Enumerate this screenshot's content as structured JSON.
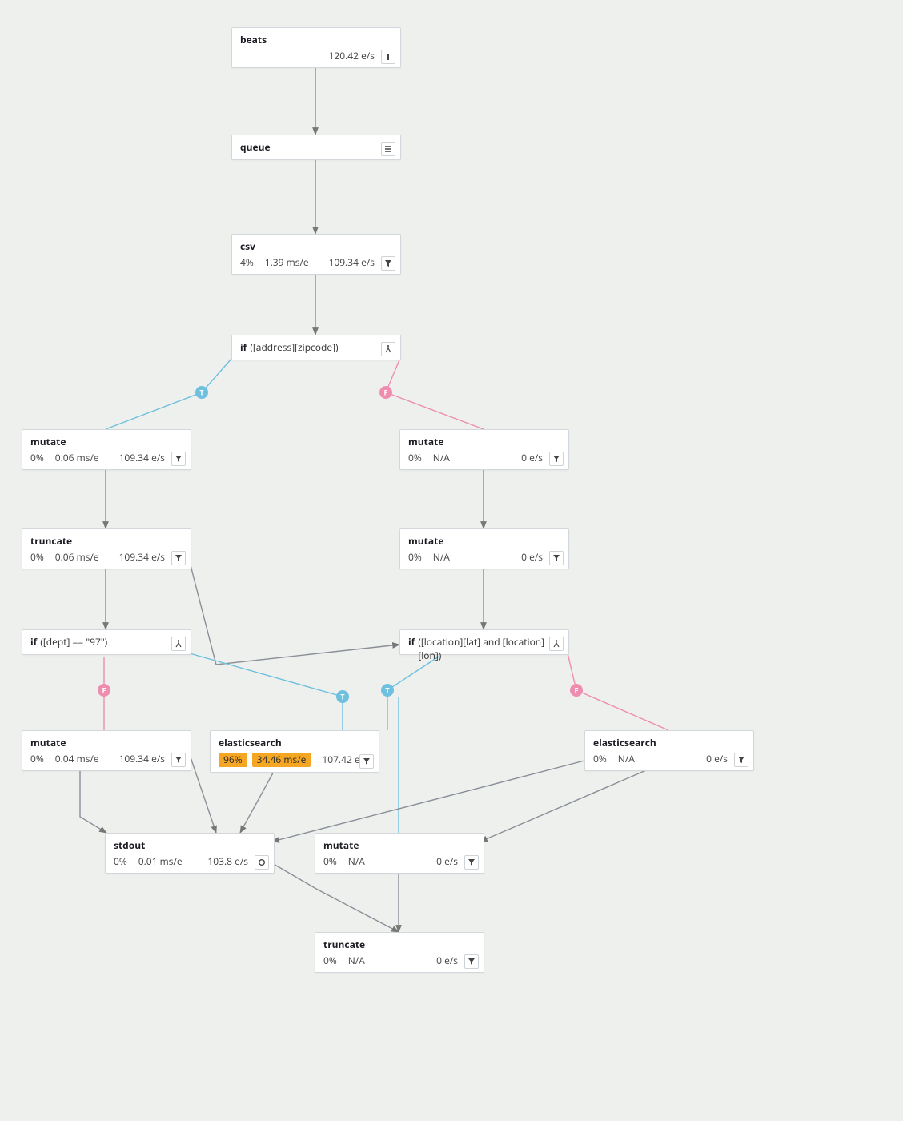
{
  "colors": {
    "true_branch": "#6ec0de",
    "false_branch": "#ef8db0",
    "highlight": "#f5a623"
  },
  "branch_labels": {
    "true": "T",
    "false": "F"
  },
  "nodes": {
    "beats": {
      "title": "beats",
      "rate": "120.42 e/s",
      "kind": "input"
    },
    "queue": {
      "title": "queue",
      "kind": "queue"
    },
    "csv": {
      "title": "csv",
      "pct": "4%",
      "lat": "1.39 ms/e",
      "rate": "109.34 e/s",
      "kind": "filter"
    },
    "if_zip": {
      "title": "if",
      "cond": "([address][zipcode])",
      "kind": "branch"
    },
    "mutate_l": {
      "title": "mutate",
      "pct": "0%",
      "lat": "0.06 ms/e",
      "rate": "109.34 e/s",
      "kind": "filter"
    },
    "mutate_r": {
      "title": "mutate",
      "pct": "0%",
      "lat": "N/A",
      "rate": "0 e/s",
      "kind": "filter"
    },
    "trunc_l": {
      "title": "truncate",
      "pct": "0%",
      "lat": "0.06 ms/e",
      "rate": "109.34 e/s",
      "kind": "filter"
    },
    "mutate_r2": {
      "title": "mutate",
      "pct": "0%",
      "lat": "N/A",
      "rate": "0 e/s",
      "kind": "filter"
    },
    "if_dept": {
      "title": "if",
      "cond": "([dept] == \"97\")",
      "kind": "branch"
    },
    "if_loc": {
      "title": "if",
      "cond": "([location][lat] and [location][lon])",
      "kind": "branch"
    },
    "mutate_bl": {
      "title": "mutate",
      "pct": "0%",
      "lat": "0.04 ms/e",
      "rate": "109.34 e/s",
      "kind": "filter"
    },
    "es_hot": {
      "title": "elasticsearch",
      "pct": "96%",
      "lat": "34.46 ms/e",
      "rate": "107.42 e/s",
      "kind": "filter",
      "highlighted": true
    },
    "es": {
      "title": "elasticsearch",
      "pct": "0%",
      "lat": "N/A",
      "rate": "0 e/s",
      "kind": "filter"
    },
    "stdout": {
      "title": "stdout",
      "pct": "0%",
      "lat": "0.01 ms/e",
      "rate": "103.8 e/s",
      "kind": "output"
    },
    "mutate_b": {
      "title": "mutate",
      "pct": "0%",
      "lat": "N/A",
      "rate": "0 e/s",
      "kind": "filter"
    },
    "trunc_b": {
      "title": "truncate",
      "pct": "0%",
      "lat": "N/A",
      "rate": "0 e/s",
      "kind": "filter"
    }
  },
  "edges": [
    {
      "from": "beats",
      "to": "queue"
    },
    {
      "from": "queue",
      "to": "csv"
    },
    {
      "from": "csv",
      "to": "if_zip"
    },
    {
      "from": "if_zip",
      "to": "mutate_l",
      "branch": "true"
    },
    {
      "from": "if_zip",
      "to": "mutate_r",
      "branch": "false"
    },
    {
      "from": "mutate_l",
      "to": "trunc_l"
    },
    {
      "from": "mutate_r",
      "to": "mutate_r2"
    },
    {
      "from": "trunc_l",
      "to": "if_dept"
    },
    {
      "from": "trunc_l",
      "to": "if_loc"
    },
    {
      "from": "mutate_r2",
      "to": "if_loc"
    },
    {
      "from": "if_dept",
      "to": "mutate_bl",
      "branch": "false"
    },
    {
      "from": "if_dept",
      "to": "es_hot",
      "branch": "true"
    },
    {
      "from": "if_loc",
      "to": "es_hot",
      "branch": "true"
    },
    {
      "from": "if_loc",
      "to": "mutate_b",
      "branch": "true"
    },
    {
      "from": "if_loc",
      "to": "es",
      "branch": "false"
    },
    {
      "from": "mutate_bl",
      "to": "stdout"
    },
    {
      "from": "es_hot",
      "to": "stdout"
    },
    {
      "from": "es",
      "to": "stdout"
    },
    {
      "from": "es",
      "to": "mutate_b"
    },
    {
      "from": "stdout",
      "to": "trunc_b"
    },
    {
      "from": "mutate_b",
      "to": "trunc_b"
    }
  ]
}
